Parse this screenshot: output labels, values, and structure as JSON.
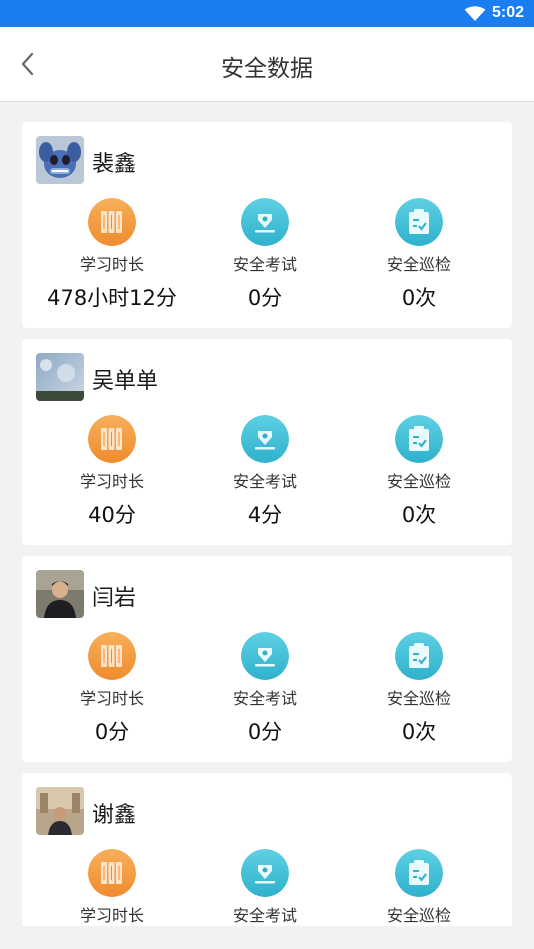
{
  "status_bar": {
    "time": "5:02",
    "icons": [
      "wifi-icon"
    ]
  },
  "header": {
    "title": "安全数据",
    "back_icon": "chevron-left-icon"
  },
  "colors": {
    "status_bar": "#1a7ef0",
    "study_icon": "#f39a3b",
    "exam_icon": "#3bbfd6",
    "patrol_icon": "#3bbfd6"
  },
  "stat_labels": {
    "study": "学习时长",
    "exam": "安全考试",
    "patrol": "安全巡检"
  },
  "users": [
    {
      "name": "裴鑫",
      "avatar": "stitch-avatar",
      "study": "478小时12分",
      "exam": "0分",
      "patrol": "0次"
    },
    {
      "name": "吴单单",
      "avatar": "sky-avatar",
      "study": "40分",
      "exam": "4分",
      "patrol": "0次"
    },
    {
      "name": "闫岩",
      "avatar": "portrait-avatar",
      "study": "0分",
      "exam": "0分",
      "patrol": "0次"
    },
    {
      "name": "谢鑫",
      "avatar": "photo-avatar",
      "study": "",
      "exam": "",
      "patrol": ""
    }
  ]
}
